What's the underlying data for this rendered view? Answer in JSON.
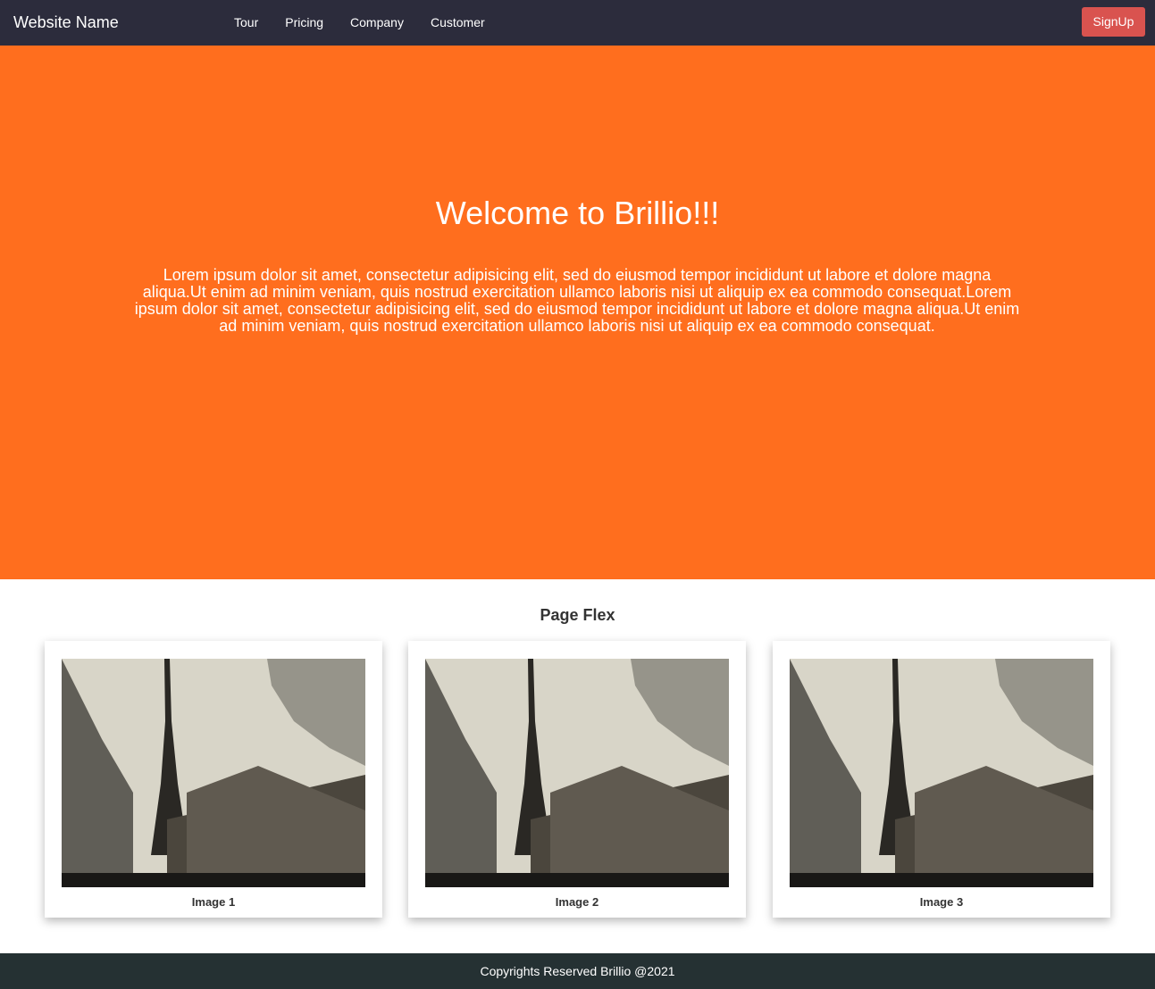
{
  "header": {
    "brand": "Website Name",
    "nav": [
      "Tour",
      "Pricing",
      "Company",
      "Customer"
    ],
    "signup_label": "SignUp"
  },
  "hero": {
    "title": "Welcome to Brillio!!!",
    "text": "Lorem ipsum dolor sit amet, consectetur adipisicing elit, sed do eiusmod tempor incididunt ut labore et dolore magna aliqua.Ut enim ad minim veniam, quis nostrud exercitation ullamco laboris nisi ut aliquip ex ea commodo consequat.Lorem ipsum dolor sit amet, consectetur adipisicing elit, sed do eiusmod tempor incididunt ut labore et dolore magna aliqua.Ut enim ad minim veniam, quis nostrud exercitation ullamco laboris nisi ut aliquip ex ea commodo consequat."
  },
  "gallery": {
    "title": "Page Flex",
    "cards": [
      {
        "caption": "Image 1"
      },
      {
        "caption": "Image 2"
      },
      {
        "caption": "Image 3"
      }
    ]
  },
  "footer": {
    "text": "Copyrights Reserved Brillio @2021"
  },
  "colors": {
    "navbar": "#2c2c3c",
    "hero": "#ff6e1e",
    "signup": "#d9534f",
    "footer": "#253133"
  }
}
